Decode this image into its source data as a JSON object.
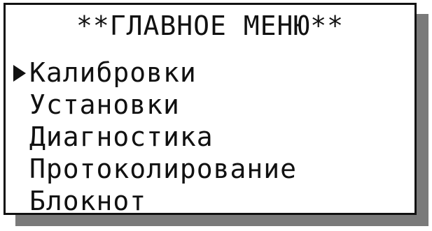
{
  "screen": {
    "title": "**ГЛАВНОЕ МЕНЮ**",
    "selected_index": 0,
    "cursor_icon": "pointer-triangle-icon",
    "menu": [
      {
        "label": "Калибровки"
      },
      {
        "label": "Установки"
      },
      {
        "label": "Диагностика"
      },
      {
        "label": "Протоколирование"
      },
      {
        "label": "Блокнот"
      }
    ]
  },
  "colors": {
    "foreground": "#111111",
    "background": "#ffffff",
    "shadow": "#7a7a7a"
  }
}
